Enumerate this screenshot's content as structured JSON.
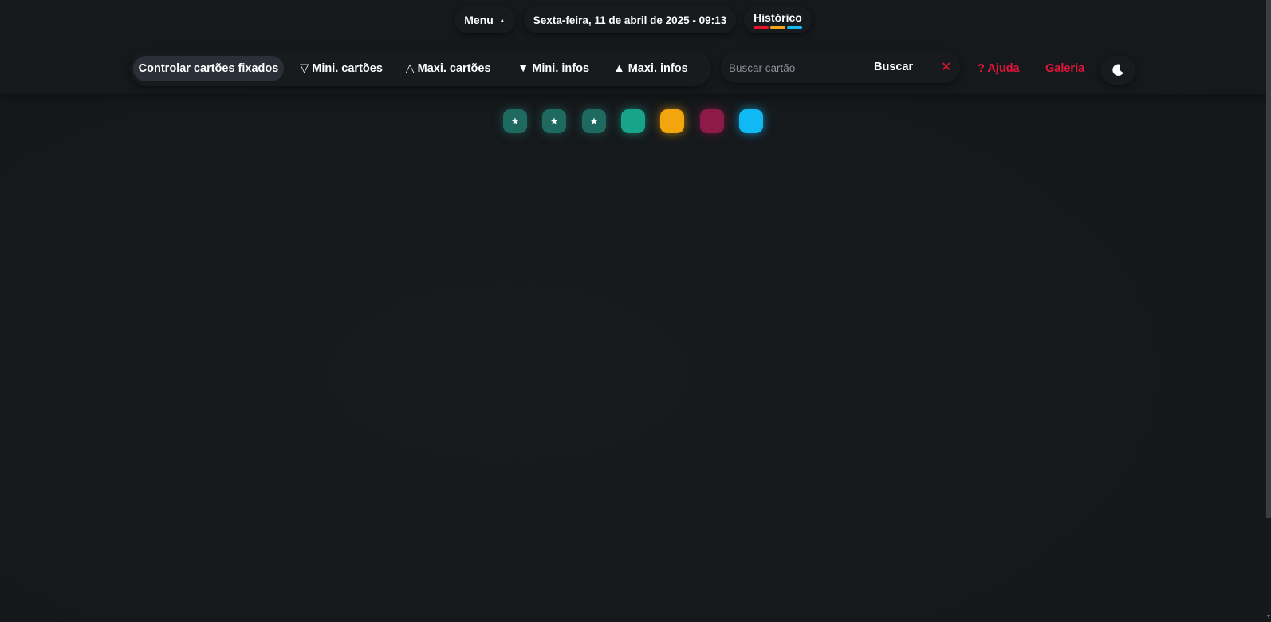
{
  "header": {
    "menu_label": "Menu",
    "menu_caret": "▲",
    "date_time": "Sexta-feira, 11 de abril de 2025 - 09:13",
    "history_label": "Histórico",
    "history_bar_colors": [
      "#e5172f",
      "#f5a614",
      "#17b8f0"
    ]
  },
  "toolbar": {
    "pinned_label": "Controlar cartões fixados",
    "mini_cards": {
      "glyph": "▽",
      "label": "Mini. cartões"
    },
    "maxi_cards": {
      "glyph": "△",
      "label": "Maxi. cartões"
    },
    "mini_infos": {
      "glyph": "▼",
      "label": "Mini. infos"
    },
    "maxi_infos": {
      "glyph": "▲",
      "label": "Maxi. infos"
    }
  },
  "search": {
    "placeholder": "Buscar cartão",
    "value": "",
    "button_label": "Buscar",
    "clear_glyph": "✕"
  },
  "links": {
    "help": "? Ajuda",
    "gallery": "Galeria"
  },
  "theme_toggle": {
    "icon": "moon-icon"
  },
  "color_squares": [
    {
      "color": "#1f6a60",
      "glyph": "★"
    },
    {
      "color": "#1f6a60",
      "glyph": "★"
    },
    {
      "color": "#1f6a60",
      "glyph": "★"
    },
    {
      "color": "#18a488",
      "glyph": ""
    },
    {
      "color": "#f2a50d",
      "glyph": ""
    },
    {
      "color": "#8d1b4a",
      "glyph": ""
    },
    {
      "color": "#10b8f4",
      "glyph": ""
    }
  ],
  "colors": {
    "background": "#16191c",
    "accent_red": "#e0153a",
    "active_button": "#2b3038"
  }
}
